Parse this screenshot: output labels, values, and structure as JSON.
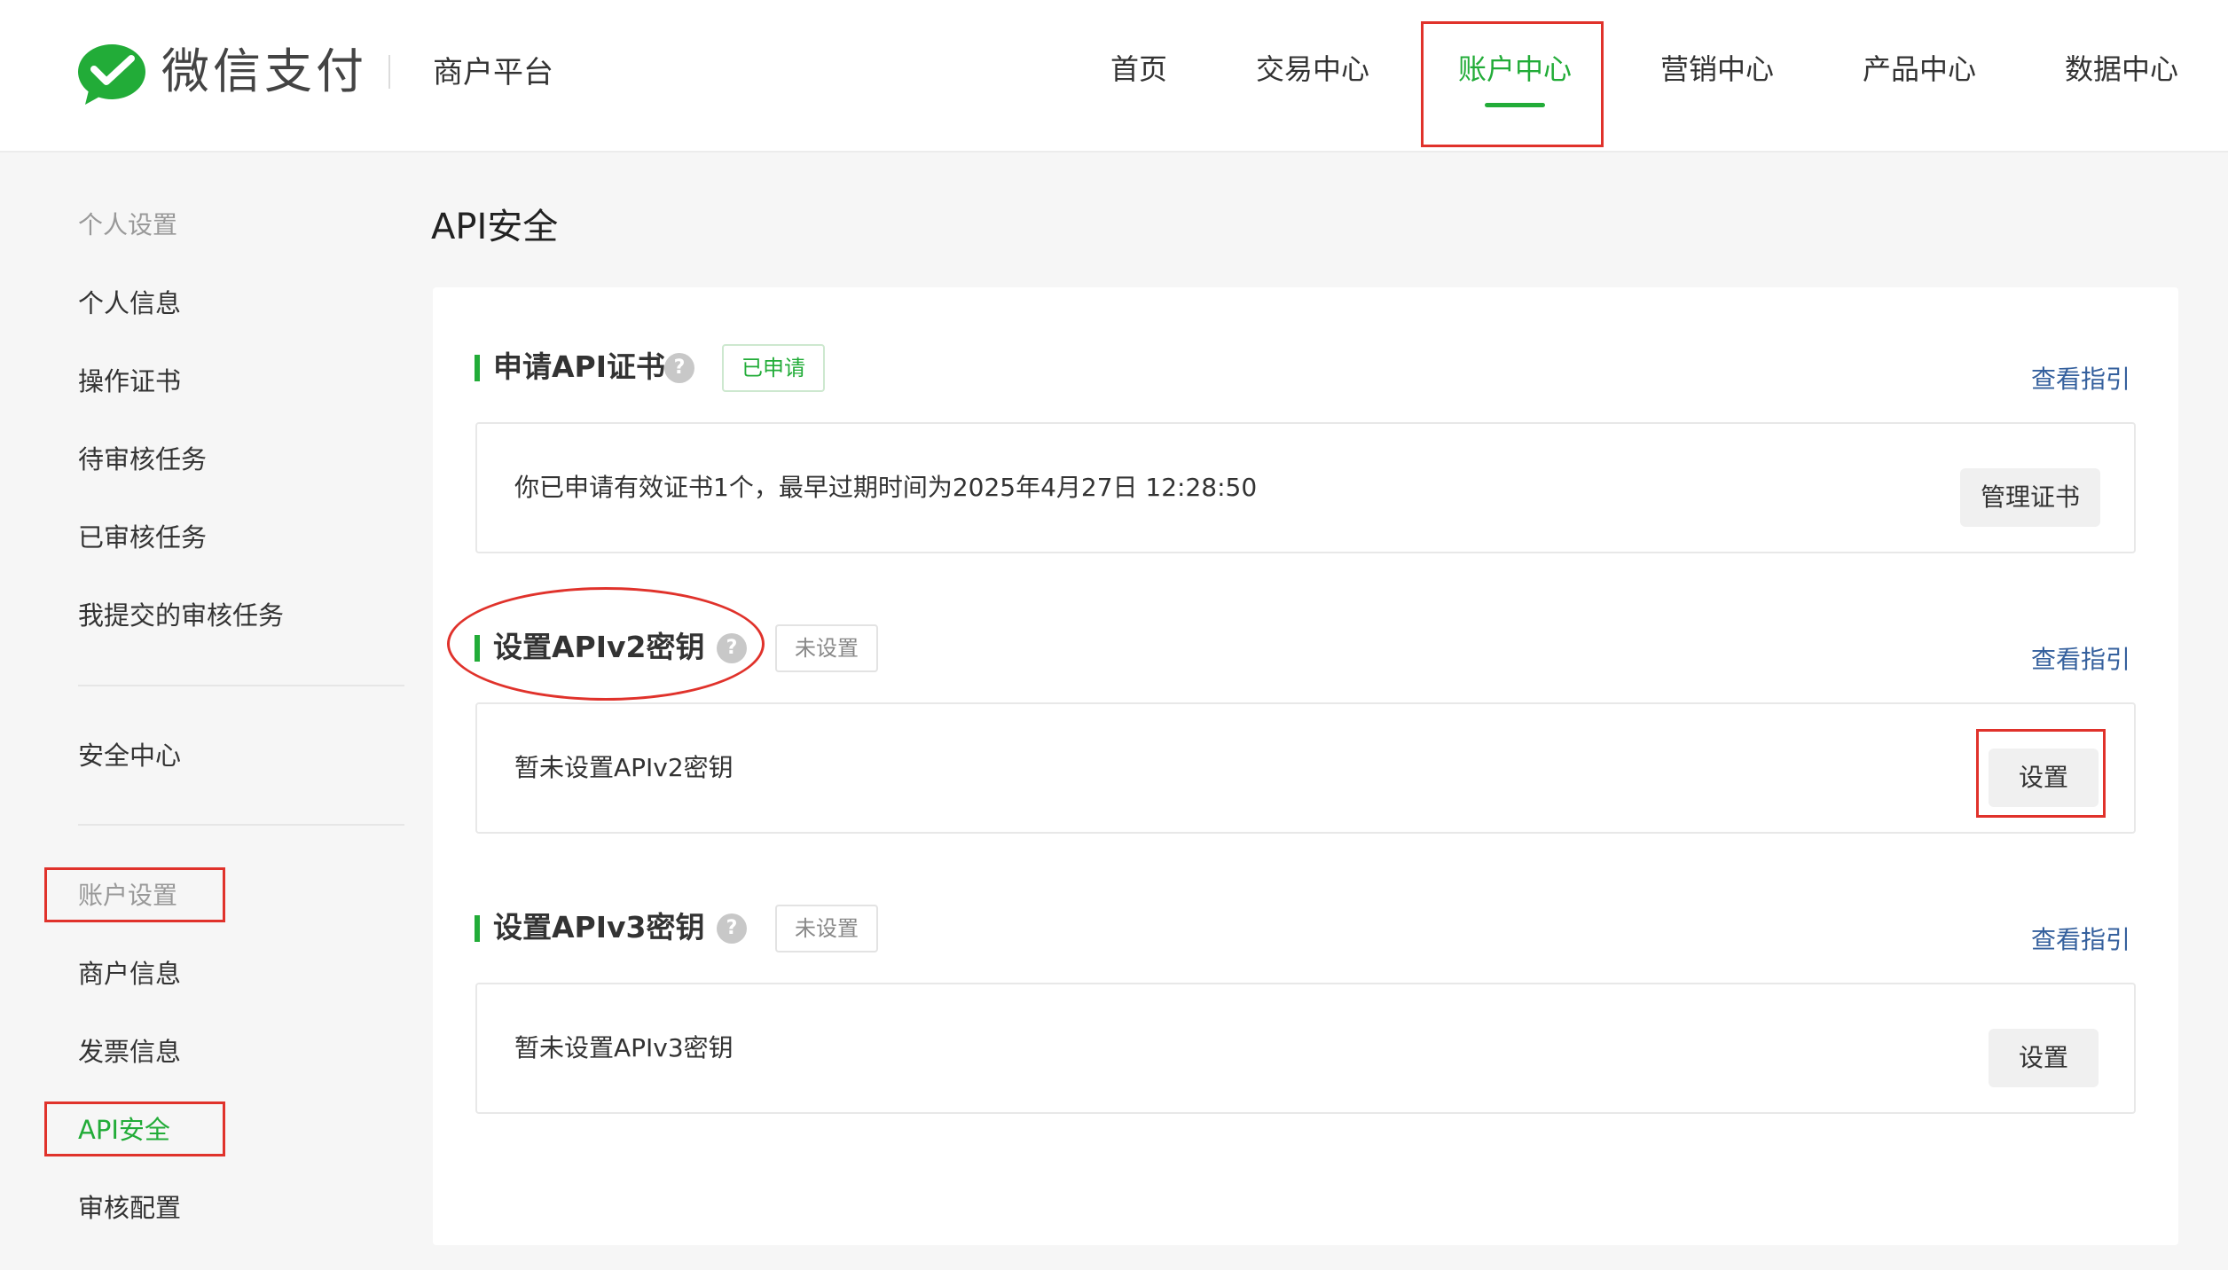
{
  "header": {
    "brand": "微信支付",
    "platform": "商户平台",
    "nav": [
      {
        "label": "首页",
        "active": false
      },
      {
        "label": "交易中心",
        "active": false
      },
      {
        "label": "账户中心",
        "active": true
      },
      {
        "label": "营销中心",
        "active": false
      },
      {
        "label": "产品中心",
        "active": false
      },
      {
        "label": "数据中心",
        "active": false
      }
    ]
  },
  "sidebar": {
    "group_personal": "个人设置",
    "personal_items": [
      "个人信息",
      "操作证书",
      "待审核任务",
      "已审核任务",
      "我提交的审核任务"
    ],
    "security_center": "安全中心",
    "group_account": "账户设置",
    "account_items": [
      "商户信息",
      "发票信息",
      "API安全",
      "审核配置"
    ],
    "active_item": "API安全"
  },
  "main": {
    "title": "API安全",
    "sections": [
      {
        "title": "申请API证书",
        "status": "已申请",
        "guide": "查看指引",
        "text": "你已申请有效证书1个，最早过期时间为2025年4月27日 12:28:50",
        "button": "管理证书"
      },
      {
        "title": "设置APIv2密钥",
        "status": "未设置",
        "guide": "查看指引",
        "text": "暂未设置APIv2密钥",
        "button": "设置"
      },
      {
        "title": "设置APIv3密钥",
        "status": "未设置",
        "guide": "查看指引",
        "text": "暂未设置APIv3密钥",
        "button": "设置"
      }
    ]
  },
  "help_glyph": "?",
  "colors": {
    "accent_green": "#22ac38",
    "link_blue": "#35609d",
    "annotation_red": "#e0322b"
  }
}
